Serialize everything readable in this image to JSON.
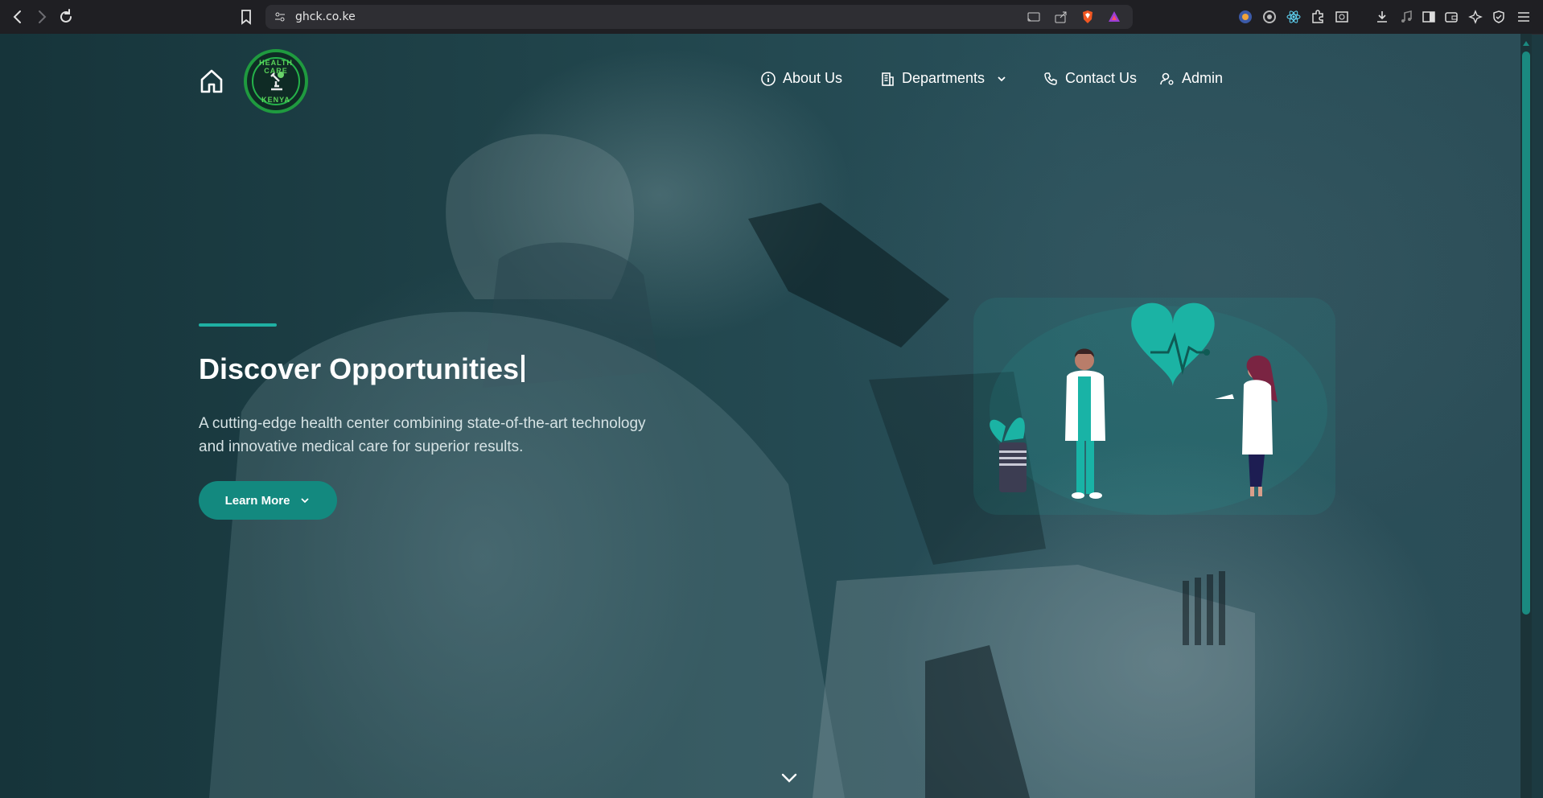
{
  "browser": {
    "url": "ghck.co.ke"
  },
  "header": {
    "logo_text_top": "HEALTH CARE",
    "logo_text_bottom": "KENYA",
    "nav": [
      {
        "label": "About Us",
        "icon": "info-icon"
      },
      {
        "label": "Departments",
        "icon": "building-icon",
        "dropdown": true
      },
      {
        "label": "Contact Us",
        "icon": "phone-icon"
      },
      {
        "label": "Admin",
        "icon": "user-gear-icon"
      }
    ]
  },
  "hero": {
    "title": "Discover Opportunities",
    "subtitle": "A cutting-edge health center combining state-of-the-art technology and innovative medical care for superior results.",
    "cta_label": "Learn More"
  },
  "colors": {
    "accent": "#13897f",
    "accent_light": "#1fb0a3",
    "background": "#1c3a41",
    "illustration_teal": "#19b3a6"
  }
}
